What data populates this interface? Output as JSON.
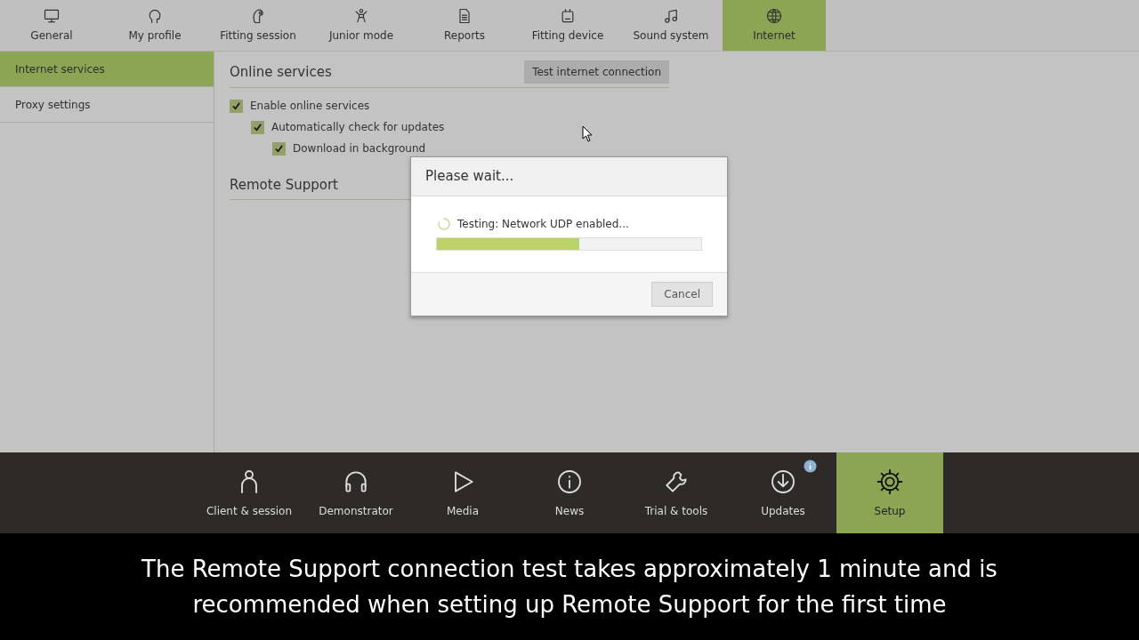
{
  "top_tabs": [
    {
      "label": "General",
      "selected": false
    },
    {
      "label": "My profile",
      "selected": false
    },
    {
      "label": "Fitting session",
      "selected": false
    },
    {
      "label": "Junior mode",
      "selected": false
    },
    {
      "label": "Reports",
      "selected": false
    },
    {
      "label": "Fitting device",
      "selected": false
    },
    {
      "label": "Sound system",
      "selected": false
    },
    {
      "label": "Internet",
      "selected": true
    }
  ],
  "sidebar": {
    "items": [
      {
        "label": "Internet services",
        "selected": true
      },
      {
        "label": "Proxy settings",
        "selected": false
      }
    ]
  },
  "sections": [
    {
      "title": "Online services",
      "button": "Test internet connection",
      "options": [
        {
          "label": "Enable online services",
          "checked": true,
          "children": [
            {
              "label": "Automatically check for updates",
              "checked": true,
              "children": [
                {
                  "label": "Download in background",
                  "checked": true
                }
              ]
            }
          ]
        }
      ]
    },
    {
      "title": "Remote Support"
    }
  ],
  "dialog": {
    "title": "Please wait...",
    "status": "Testing: Network UDP enabled...",
    "level": 0.54,
    "button": "Cancel"
  },
  "bottom_nav": [
    {
      "label": "Client & session",
      "selected": false,
      "notification": false
    },
    {
      "label": "Demonstrator",
      "selected": false,
      "notification": false
    },
    {
      "label": "Media",
      "selected": false,
      "notification": false
    },
    {
      "label": "News",
      "selected": false,
      "notification": false
    },
    {
      "label": "Trial & tools",
      "selected": false,
      "notification": false
    },
    {
      "label": "Updates",
      "selected": false,
      "notification": true
    },
    {
      "label": "Setup",
      "selected": true,
      "notification": false
    }
  ],
  "caption": [
    "The Remote Support connection test takes approximately 1 minute and is",
    "recommended when setting up Remote Support for the first time"
  ]
}
